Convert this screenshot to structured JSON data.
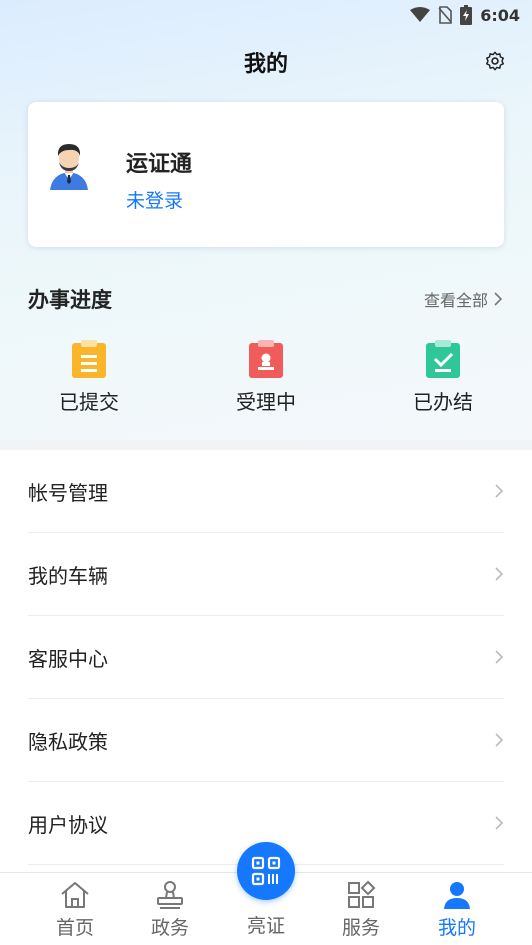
{
  "status_bar": {
    "time": "6:04"
  },
  "header": {
    "title": "我的"
  },
  "profile": {
    "name": "运证通",
    "status": "未登录"
  },
  "progress": {
    "title": "办事进度",
    "view_all": "查看全部",
    "items": [
      {
        "label": "已提交",
        "icon": "clipboard-yellow-icon",
        "color": "#fbb52a"
      },
      {
        "label": "受理中",
        "icon": "stamp-red-icon",
        "color": "#f05b5b"
      },
      {
        "label": "已办结",
        "icon": "clipboard-check-green-icon",
        "color": "#2fc79a"
      }
    ]
  },
  "menu": [
    {
      "label": "帐号管理"
    },
    {
      "label": "我的车辆"
    },
    {
      "label": "客服中心"
    },
    {
      "label": "隐私政策"
    },
    {
      "label": "用户协议"
    }
  ],
  "tabs": [
    {
      "label": "首页",
      "icon": "home-icon"
    },
    {
      "label": "政务",
      "icon": "stamp-icon"
    },
    {
      "label": "亮证",
      "icon": "qr-code-icon"
    },
    {
      "label": "服务",
      "icon": "grid-icon"
    },
    {
      "label": "我的",
      "icon": "user-icon",
      "active": true
    }
  ],
  "colors": {
    "accent": "#1677ff"
  }
}
